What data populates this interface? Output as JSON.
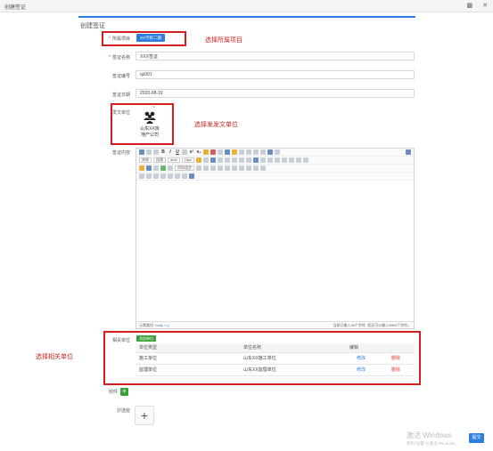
{
  "window": {
    "title": "创建签证"
  },
  "form": {
    "title": "创建签证",
    "project": {
      "label": "所属项目",
      "value": "XX学校二期"
    },
    "name": {
      "label": "签证名称",
      "value": "XXX签证"
    },
    "code": {
      "label": "签证编号",
      "value": "qz001"
    },
    "date": {
      "label": "签证日期",
      "value": "2020-08-19"
    },
    "unit": {
      "label": "发文单位",
      "name_line1": "山东XX房",
      "name_line2": "地产公司"
    },
    "content": {
      "label": "签证内容"
    },
    "related": {
      "label": "相关单位",
      "add_button": "添加单位"
    },
    "attachment": {
      "label": "附件"
    },
    "cc": {
      "label": "抄送给"
    }
  },
  "editor": {
    "font_family": "宋体",
    "paragraph": "段落",
    "font": "arial",
    "size": "16px",
    "code_lang": "代码语言",
    "path_label": "元素路径:",
    "path_body": "body",
    "path_p": "p",
    "counter": "当前已输入36个字符, 您还可以输入9964个字符。"
  },
  "table": {
    "headers": [
      "单位类型",
      "单位名称",
      "编辑"
    ],
    "rows": [
      {
        "type": "施工单位",
        "name": "山东XX施工单位",
        "edit": "修改",
        "delete": "删除"
      },
      {
        "type": "监理单位",
        "name": "山东XX监理单位",
        "edit": "修改",
        "delete": "删除"
      }
    ]
  },
  "annotations": {
    "project": "选择所属项目",
    "unit": "选择发发文单位",
    "related": "选择相关单位"
  },
  "watermark": {
    "line1": "激活 Windows",
    "line2": "转到\"设置\"以激活 Windows。"
  },
  "submit_label": "提交",
  "colors": {
    "accent": "#2d7ee0",
    "annotation": "#d01f1f",
    "add_green": "#3aa03a",
    "delete_red": "#e53935"
  }
}
